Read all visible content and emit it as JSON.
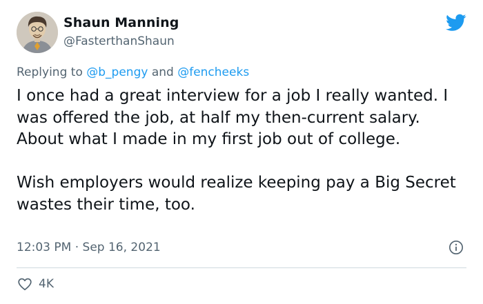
{
  "author": {
    "name": "Shaun Manning",
    "handle": "@FasterthanShaun"
  },
  "reply": {
    "prefix": "Replying to ",
    "mention_1": "@b_pengy",
    "joiner": " and ",
    "mention_2": "@fencheeks"
  },
  "body": {
    "paragraph_1": "I once had a great interview for a job I really wanted. I was offered the job, at half my then-current salary. About what I made in my first job out of college.",
    "paragraph_2": "Wish employers would realize keeping pay a Big Secret wastes their time, too."
  },
  "meta": {
    "time": "12:03 PM",
    "separator": " · ",
    "date": "Sep 16, 2021"
  },
  "actions": {
    "likes": "4K"
  },
  "icons": {
    "brand": "twitter-bird-icon",
    "info": "info-icon",
    "like": "heart-icon"
  },
  "colors": {
    "brand": "#1d9bf0",
    "text": "#0f1419",
    "secondary": "#536471",
    "divider": "#cfd9de"
  }
}
